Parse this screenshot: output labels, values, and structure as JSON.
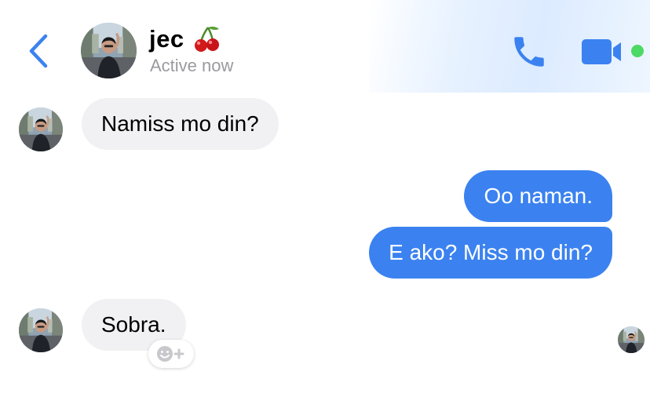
{
  "header": {
    "contact_name": "jec",
    "name_emoji": "cherries",
    "status": "Active now",
    "back_icon": "chevron-left-icon",
    "call_icon": "phone-icon",
    "video_icon": "video-camera-icon",
    "accent_color": "#3b82f0",
    "online_color": "#4cd964"
  },
  "messages": [
    {
      "direction": "received",
      "text": "Namiss mo din?"
    },
    {
      "direction": "sent",
      "text": "Oo naman."
    },
    {
      "direction": "sent",
      "text": "E ako? Miss mo din?"
    },
    {
      "direction": "received",
      "text": "Sobra."
    }
  ],
  "reaction_button": {
    "icon": "smiley-plus-icon"
  },
  "colors": {
    "sent_bubble": "#3b82f0",
    "received_bubble": "#f1f1f3",
    "status_text": "#9a9a9f"
  }
}
